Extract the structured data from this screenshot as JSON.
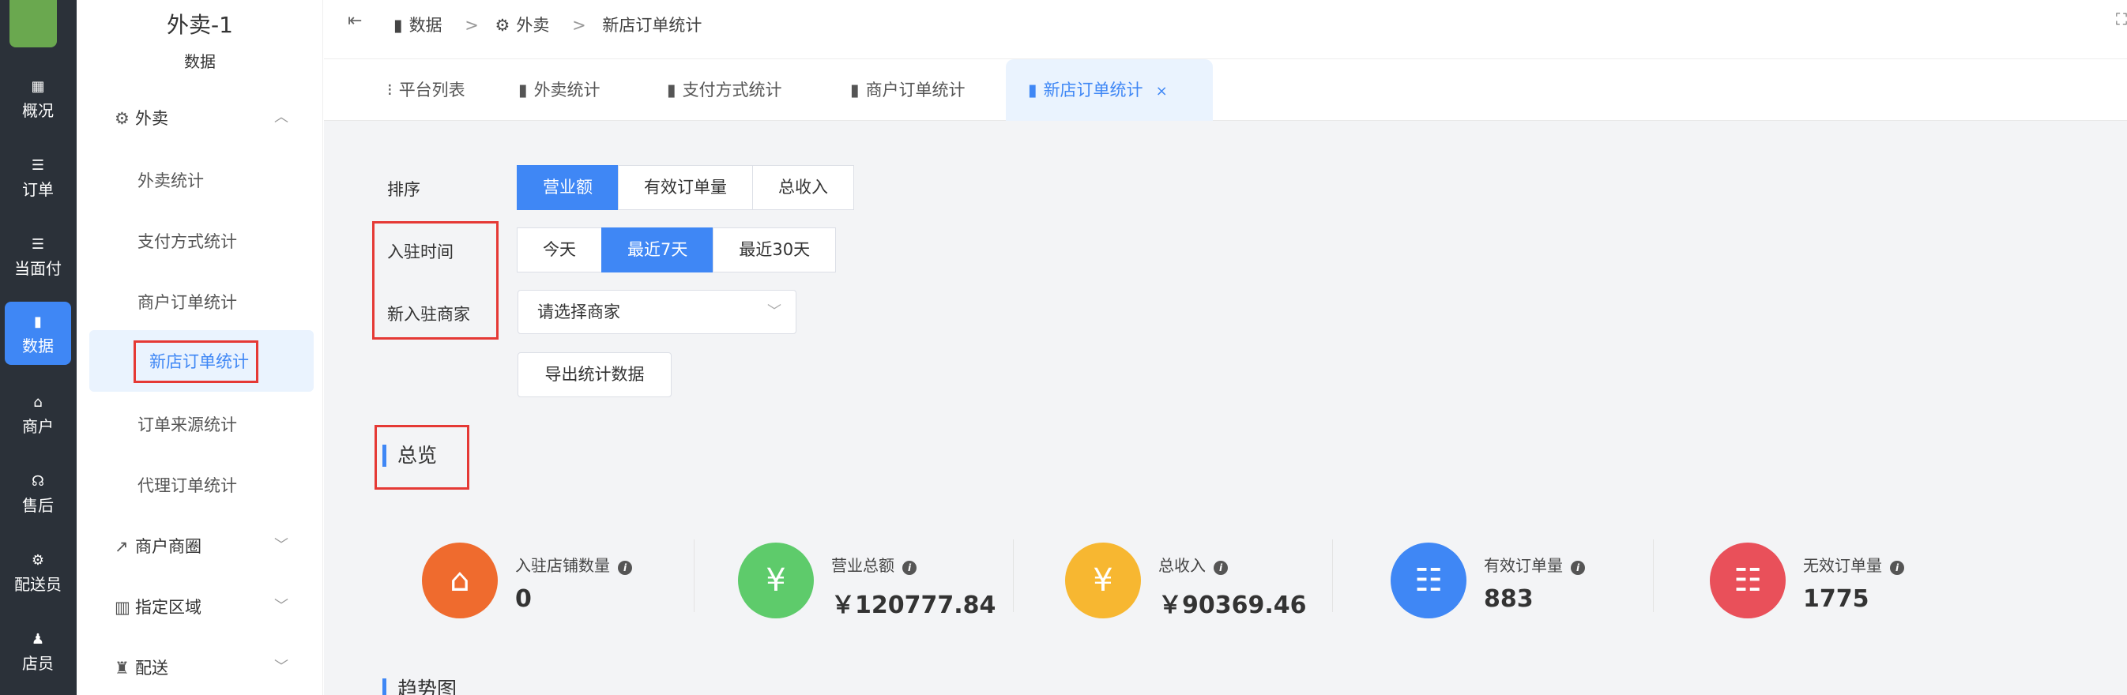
{
  "rail": {
    "items": [
      {
        "label": "概况",
        "icon": "dashboard-icon",
        "glyph": "▦"
      },
      {
        "label": "订单",
        "icon": "list-icon",
        "glyph": "☰"
      },
      {
        "label": "当面付",
        "icon": "list-icon",
        "glyph": "☰"
      },
      {
        "label": "数据",
        "icon": "bar-chart-icon",
        "glyph": "▮"
      },
      {
        "label": "商户",
        "icon": "store-icon",
        "glyph": "⌂"
      },
      {
        "label": "售后",
        "icon": "headset-icon",
        "glyph": "☊"
      },
      {
        "label": "配送员",
        "icon": "scooter-icon",
        "glyph": "⚙"
      },
      {
        "label": "店员",
        "icon": "users-icon",
        "glyph": "♟"
      }
    ]
  },
  "sidebar": {
    "title": "外卖-1",
    "subtitle": "数据",
    "groups": [
      {
        "label": "外卖",
        "icon": "scooter-icon",
        "glyph": "⚙"
      },
      {
        "label": "商户商圈",
        "icon": "line-chart-icon",
        "glyph": "↗"
      },
      {
        "label": "指定区域",
        "icon": "bar-chart-icon",
        "glyph": "▥"
      },
      {
        "label": "配送",
        "icon": "bag-icon",
        "glyph": "♜"
      }
    ],
    "subitems": [
      "外卖统计",
      "支付方式统计",
      "商户订单统计",
      "新店订单统计",
      "订单来源统计",
      "代理订单统计"
    ]
  },
  "topbar": {
    "collapse_glyph": "⇤",
    "fullscreen_glyph": "⛶",
    "crumbs": [
      "数据",
      "外卖",
      "新店订单统计"
    ],
    "sep": ">"
  },
  "tabs": [
    {
      "label": "平台列表",
      "icon": "grid-list-icon",
      "glyph": "⁝"
    },
    {
      "label": "外卖统计",
      "icon": "bar-chart-icon",
      "glyph": "▮"
    },
    {
      "label": "支付方式统计",
      "icon": "bar-chart-icon",
      "glyph": "▮"
    },
    {
      "label": "商户订单统计",
      "icon": "bar-chart-icon",
      "glyph": "▮"
    },
    {
      "label": "新店订单统计",
      "icon": "bar-chart-icon",
      "glyph": "▮",
      "close": "×"
    }
  ],
  "filters": {
    "sort_label": "排序",
    "sort_options": [
      "营业额",
      "有效订单量",
      "总收入"
    ],
    "time_label": "入驻时间",
    "time_options": [
      "今天",
      "最近7天",
      "最近30天"
    ],
    "merchant_label": "新入驻商家",
    "merchant_placeholder": "请选择商家",
    "export_label": "导出统计数据"
  },
  "overview": {
    "title": "总览",
    "stats": [
      {
        "label": "入驻店铺数量",
        "value": "0",
        "color": "#ef6b2e",
        "icon": "store-icon",
        "glyph": "⌂"
      },
      {
        "label": "营业总额",
        "value": "￥120777.84",
        "color": "#5ecb6b",
        "icon": "yen-icon",
        "glyph": "¥"
      },
      {
        "label": "总收入",
        "value": "￥90369.46",
        "color": "#f7b731",
        "icon": "yen-icon",
        "glyph": "¥"
      },
      {
        "label": "有效订单量",
        "value": "883",
        "color": "#3f87f5",
        "icon": "clipboard-icon",
        "glyph": "☷"
      },
      {
        "label": "无效订单量",
        "value": "1775",
        "color": "#e9505a",
        "icon": "clipboard-icon",
        "glyph": "☷"
      }
    ],
    "info_glyph": "i"
  },
  "trend": {
    "title": "趋势图"
  },
  "colors": {
    "accent": "#3f87f5",
    "rail_bg": "#2b3139",
    "highlight": "#e53935"
  }
}
